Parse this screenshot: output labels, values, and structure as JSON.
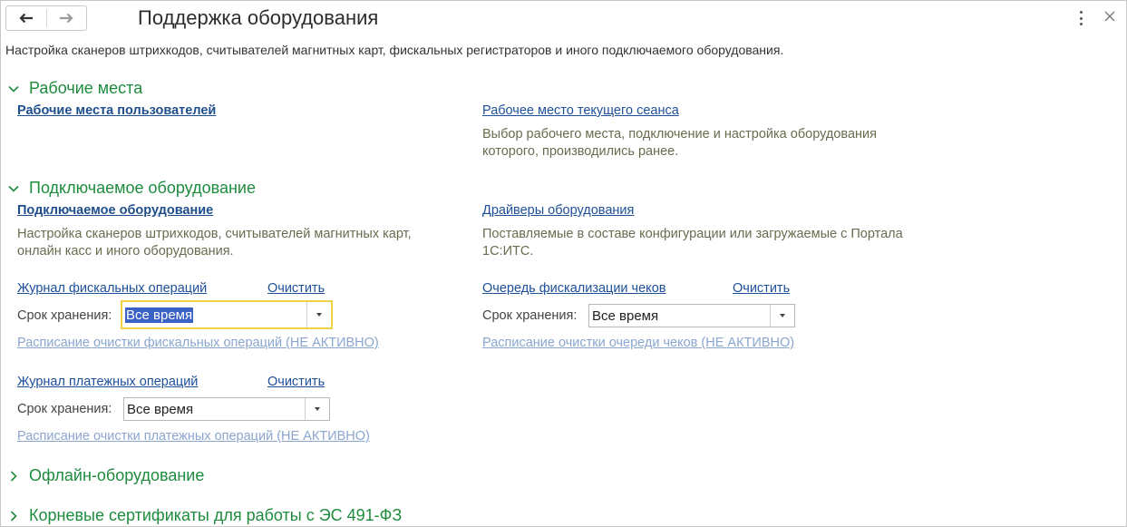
{
  "header": {
    "title": "Поддержка оборудования",
    "description": "Настройка сканеров штрихкодов, считывателей магнитных карт, фискальных регистраторов и иного подключаемого оборудования."
  },
  "sections": {
    "workplaces": {
      "title": "Рабочие места",
      "user_workplaces_link": "Рабочие места пользователей",
      "current_session_link": "Рабочее место текущего сеанса",
      "current_session_note": "Выбор рабочего места, подключение и настройка оборудования которого, производились ранее."
    },
    "equipment": {
      "title": "Подключаемое оборудование",
      "equipment_link": "Подключаемое оборудование",
      "equipment_note": "Настройка сканеров штрихкодов, считывателей магнитных карт, онлайн касс и иного оборудования.",
      "drivers_link": "Драйверы оборудования",
      "drivers_note": "Поставляемые в составе конфигурации или загружаемые с Портала 1С:ИТС.",
      "fiscal_log": {
        "link": "Журнал фискальных операций",
        "clear": "Очистить",
        "retention_label": "Срок хранения:",
        "retention_value": "Все время",
        "schedule_link": "Расписание очистки фискальных операций (НЕ АКТИВНО)"
      },
      "receipt_queue": {
        "link": "Очередь фискализации чеков",
        "clear": "Очистить",
        "retention_label": "Срок хранения:",
        "retention_value": "Все время",
        "schedule_link": "Расписание очистки очереди чеков (НЕ АКТИВНО)"
      },
      "payment_log": {
        "link": "Журнал платежных операций",
        "clear": "Очистить",
        "retention_label": "Срок хранения:",
        "retention_value": "Все время",
        "schedule_link": "Расписание очистки платежных операций (НЕ АКТИВНО)"
      }
    },
    "offline": {
      "title": "Офлайн-оборудование"
    },
    "certificates": {
      "title": "Корневые сертификаты для работы с ЭС 491-ФЗ"
    }
  },
  "colors": {
    "section_title": "#1e8b3e",
    "link": "#1d4f9a",
    "inactive_link": "#8aa6cf",
    "note_text": "#6b6b4f",
    "focus_border": "#f0d04a",
    "selection": "#3a62c6"
  },
  "icons": {
    "back": "arrow-left-icon",
    "forward": "arrow-right-icon",
    "more": "more-vertical-icon",
    "close": "close-icon",
    "expanded": "chevron-down-icon",
    "collapsed": "chevron-right-icon",
    "dropdown": "caret-down-icon"
  }
}
